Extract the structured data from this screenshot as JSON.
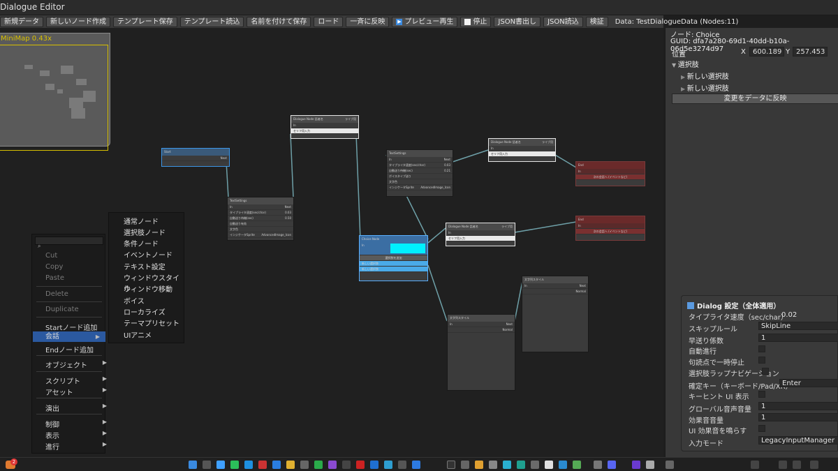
{
  "window": {
    "title": "Dialogue Editor"
  },
  "toolbar": {
    "new_data": "新規データ",
    "new_node": "新しいノード作成",
    "save_template": "テンプレート保存",
    "load_template": "テンプレート読込",
    "save_as": "名前を付けて保存",
    "load": "ロード",
    "apply_all": "一斉に反映",
    "preview": "プレビュー再生",
    "stop": "停止",
    "json_export": "JSON書出し",
    "json_import": "JSON読込",
    "verify": "検証",
    "status": "Data: TestDialogueData (Nodes:11)"
  },
  "minimap": {
    "title": "MiniMap  0.43x"
  },
  "nodes": {
    "start": {
      "title": "Start",
      "port": "Next"
    },
    "dialogue1": {
      "title": "Dialogue Node",
      "sub": "話者名",
      "btn": "ライブ用",
      "in": "In",
      "input": "セリフ用入力"
    },
    "text1": {
      "title": "TextSettings",
      "in": "In",
      "out": "Next",
      "r1": "タイプライタ速度(sec/char)",
      "v1": "0.03",
      "r2": "自動送り待機(sec)",
      "v2": "0.50",
      "r3": "自動送り有効",
      "r4": "ボイスタイプ送り",
      "r5": "文字色",
      "r6": "インジケータSprite",
      "v6": "AdvancedImage_Icon"
    },
    "text2": {
      "title": "TextSettings",
      "in": "In",
      "out": "Next",
      "r1": "タイプライタ速度(sec/char)",
      "v1": "0.03",
      "r2": "自動送り待機(sec)",
      "v2": "0.21",
      "r3": "自動送り有効",
      "r4": "ボイスタイプ送り",
      "r5": "文字色",
      "r6": "インジケータSprite",
      "v6": "AdvancedImage_Icon"
    },
    "choice": {
      "title": "Choice Node",
      "in": "In",
      "add": "選択肢を追加",
      "o1": "新しい選択肢",
      "o2": "新しい選択肢"
    },
    "dialogue2": {
      "title": "Dialogue Node",
      "sub": "話者名",
      "btn": "ライブ用",
      "in": "In",
      "input": "セリフ用入力"
    },
    "dialogue3": {
      "title": "Dialogue Node",
      "sub": "話者名",
      "btn": "ライブ用",
      "in": "In",
      "input": "セリフ用入力"
    },
    "end1": {
      "title": "End",
      "in": "In",
      "note": "次の会話へ (イベントなど)"
    },
    "end2": {
      "title": "End",
      "in": "In",
      "note": "次の会話へ (イベントなど)"
    },
    "style1": {
      "title": "文字列スタイル",
      "in": "In",
      "out": "Next",
      "mode": "Normal"
    },
    "style2": {
      "title": "文字列スタイル",
      "in": "In",
      "out": "Next",
      "mode": "Normal"
    }
  },
  "context_menu": {
    "items": [
      "Cut",
      "Copy",
      "Paste",
      "Delete",
      "Duplicate",
      "Startノード追加",
      "会話",
      "Endノード追加",
      "オブジェクト",
      "スクリプト",
      "アセット",
      "演出",
      "制御",
      "表示",
      "進行"
    ]
  },
  "submenu": {
    "items": [
      "通常ノード",
      "選択肢ノード",
      "条件ノード",
      "イベントノード",
      "テキスト設定",
      "ウィンドウスタイル",
      "ウィンドウ移動",
      "ボイス",
      "ローカライズ",
      "テーマプリセット",
      "UIアニメ"
    ]
  },
  "inspector": {
    "node_label": "ノード: Choice",
    "guid": "GUID: dfa7a280-69d1-40dd-b10a-06d5e3274d97",
    "pos_label": "位置",
    "x_label": "X",
    "x_value": "600.189",
    "y_label": "Y",
    "y_value": "257.453",
    "choices_label": "選択肢",
    "choice1": "新しい選択肢",
    "choice2": "新しい選択肢",
    "reflect": "変更をデータに反映"
  },
  "dialog_settings": {
    "title": "Dialog 設定（全体適用）",
    "typewriter_label": "タイプライタ速度（sec/char）",
    "typewriter_value": "0.02",
    "skip_label": "スキップルール",
    "skip_value": "SkipLine",
    "fast_label": "早送り係数",
    "fast_value": "1",
    "auto_label": "自動進行",
    "pause_label": "句読点で一時停止",
    "wrap_label": "選択肢ラップナビゲーション",
    "confirm_label": "確定キー（キーボード/Pad/XR）",
    "confirm_value": "Enter",
    "hint_label": "キーヒント UI 表示",
    "gvol_label": "グローバル音声音量",
    "gvol_value": "1",
    "sfx_label": "効果音音量",
    "sfx_value": "1",
    "uisfx_label": "UI 効果音を鳴らす",
    "input_label": "入力モード",
    "input_value": "LegacyInputManager"
  },
  "taskbar": {
    "badge": "2"
  }
}
